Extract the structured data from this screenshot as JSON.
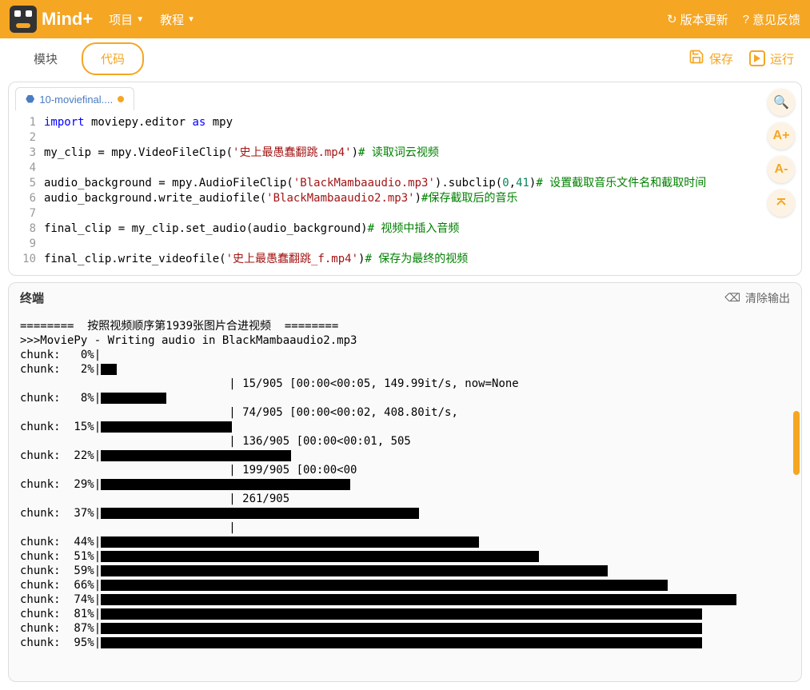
{
  "header": {
    "logo_text": "Mind+",
    "menu_project": "项目",
    "menu_tutorial": "教程",
    "version_update": "版本更新",
    "feedback": "意见反馈"
  },
  "toolbar": {
    "tab_blocks": "模块",
    "tab_code": "代码",
    "save": "保存",
    "run": "运行"
  },
  "file_tab": {
    "name": "10-moviefinal....",
    "dirty": true,
    "lang_icon": "🐍"
  },
  "code": {
    "lines": [
      {
        "n": 1,
        "t": "import",
        "r": " moviepy.editor ",
        "t2": "as",
        "r2": " mpy"
      },
      {
        "n": 2,
        "plain": ""
      },
      {
        "n": 3,
        "plain": "my_clip = mpy.VideoFileClip(",
        "str": "'史上最愚蠢翻跳.mp4'",
        "after": ")",
        "cm": "# 读取词云视频"
      },
      {
        "n": 4,
        "plain": ""
      },
      {
        "n": 5,
        "plain": "audio_background = mpy.AudioFileClip(",
        "str": "'BlackMambaaudio.mp3'",
        "after": ").subclip(",
        "num1": "0",
        "comma": ",",
        "num2": "41",
        "after2": ")",
        "cm": "# 设置截取音乐文件名和截取时间"
      },
      {
        "n": 6,
        "plain": "audio_background.write_audiofile(",
        "str": "'BlackMambaaudio2.mp3'",
        "after": ")",
        "cm": "#保存截取后的音乐"
      },
      {
        "n": 7,
        "plain": ""
      },
      {
        "n": 8,
        "plain": "final_clip = my_clip.set_audio(audio_background)",
        "cm": "# 视频中插入音频"
      },
      {
        "n": 9,
        "plain": ""
      },
      {
        "n": 10,
        "plain": "final_clip.write_videofile(",
        "str": "'史上最愚蠢翻跳_f.mp4'",
        "after": ")",
        "cm": "# 保存为最终的视频"
      }
    ]
  },
  "side_tools": {
    "search": "🔍",
    "font_plus": "A+",
    "font_minus": "A-",
    "collapse": "⌃"
  },
  "terminal": {
    "title": "终端",
    "clear": "清除输出",
    "header_line1": "========  按照视频顺序第1939张图片合进视频  ========",
    "header_line2": ">>>MoviePy - Writing audio in BlackMambaaudio2.mp3",
    "rows": [
      {
        "label": "chunk:   0%|",
        "bar": 0,
        "after": ""
      },
      {
        "label": "chunk:   2%|",
        "bar": 20,
        "after": ""
      },
      {
        "label": "",
        "bar": 0,
        "plain": "                               | 15/905 [00:00<00:05, 149.99it/s, now=None"
      },
      {
        "label": "chunk:   8%|",
        "bar": 82,
        "after": ""
      },
      {
        "label": "",
        "bar": 0,
        "plain": "                               | 74/905 [00:00<00:02, 408.80it/s,"
      },
      {
        "label": "chunk:  15%|",
        "bar": 164,
        "after": ""
      },
      {
        "label": "",
        "bar": 0,
        "plain": "                               | 136/905 [00:00<00:01, 505"
      },
      {
        "label": "chunk:  22%|",
        "bar": 238,
        "after": ""
      },
      {
        "label": "",
        "bar": 0,
        "plain": "                               | 199/905 [00:00<00"
      },
      {
        "label": "chunk:  29%|",
        "bar": 312,
        "after": ""
      },
      {
        "label": "",
        "bar": 0,
        "plain": "                               | 261/905"
      },
      {
        "label": "chunk:  37%|",
        "bar": 398,
        "after": ""
      },
      {
        "label": "",
        "bar": 0,
        "plain": "                               |"
      },
      {
        "label": "chunk:  44%|",
        "bar": 473,
        "after": ""
      },
      {
        "label": "chunk:  51%|",
        "bar": 548,
        "after": ""
      },
      {
        "label": "chunk:  59%|",
        "bar": 634,
        "after": ""
      },
      {
        "label": "chunk:  66%|",
        "bar": 709,
        "after": ""
      },
      {
        "label": "chunk:  74%|",
        "bar": 795,
        "after": ""
      },
      {
        "label": "chunk:  81%|",
        "bar": 752,
        "after": ""
      },
      {
        "label": "chunk:  87%|",
        "bar": 752,
        "after": ""
      },
      {
        "label": "chunk:  95%|",
        "bar": 752,
        "after": ""
      }
    ]
  }
}
